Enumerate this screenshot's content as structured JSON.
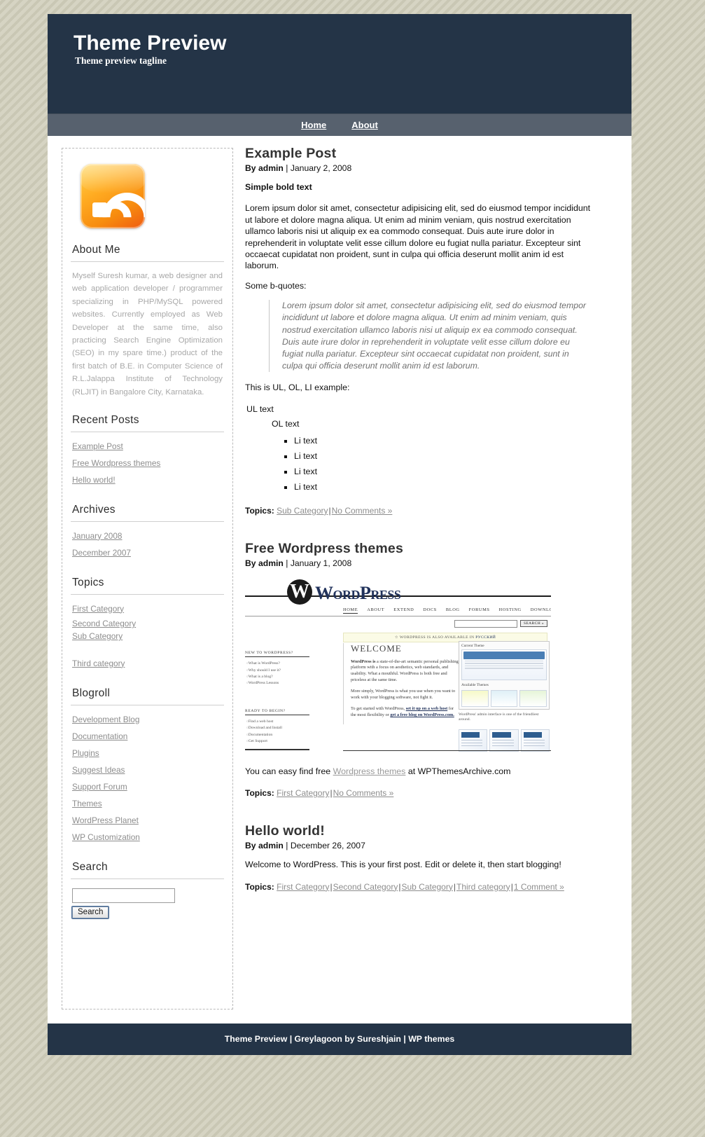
{
  "header": {
    "title": "Theme Preview",
    "tagline": "Theme preview tagline"
  },
  "nav": {
    "items": [
      {
        "label": "Home"
      },
      {
        "label": "About"
      }
    ]
  },
  "sidebar": {
    "rss_icon": "rss-feed-icon",
    "widgets": {
      "about": {
        "title": "About Me",
        "text": "Myself Suresh kumar, a web designer and web application developer / programmer specializing in PHP/MySQL powered websites. Currently employed as Web Developer at the same time, also practicing Search Engine Optimization (SEO) in my spare time.) product of the first batch of B.E. in Computer Science of R.L.Jalappa Institute of Technology (RLJIT) in Bangalore City, Karnataka."
      },
      "recent_posts": {
        "title": "Recent Posts",
        "items": [
          "Example Post",
          "Free Wordpress themes",
          "Hello world!"
        ]
      },
      "archives": {
        "title": "Archives",
        "items": [
          "January 2008",
          "December 2007"
        ]
      },
      "topics": {
        "title": "Topics",
        "items": [
          "First Category",
          "Second Category",
          "Sub Category",
          "Third category"
        ]
      },
      "blogroll": {
        "title": "Blogroll",
        "items": [
          "Development Blog",
          "Documentation",
          "Plugins",
          "Suggest Ideas",
          "Support Forum",
          "Themes",
          "WordPress Planet",
          "WP Customization"
        ]
      },
      "search": {
        "title": "Search",
        "value": "",
        "placeholder": "",
        "button_label": "Search"
      }
    }
  },
  "posts": [
    {
      "title": "Example Post",
      "byline_author": "By admin",
      "byline_sep": " | ",
      "byline_date": "January 2, 2008",
      "bold_lead": "Simple bold text",
      "body": "Lorem ipsum dolor sit amet, consectetur adipisicing elit, sed do eiusmod tempor incididunt ut labore et dolore magna aliqua. Ut enim ad minim veniam, quis nostrud exercitation ullamco laboris nisi ut aliquip ex ea commodo consequat. Duis aute irure dolor in reprehenderit in voluptate velit esse cillum dolore eu fugiat nulla pariatur. Excepteur sint occaecat cupidatat non proident, sunt in culpa qui officia deserunt mollit anim id est laborum.",
      "quote_intro": "Some b-quotes:",
      "quote": "Lorem ipsum dolor sit amet, consectetur adipisicing elit, sed do eiusmod tempor incididunt ut labore et dolore magna aliqua. Ut enim ad minim veniam, quis nostrud exercitation ullamco laboris nisi ut aliquip ex ea commodo consequat. Duis aute irure dolor in reprehenderit in voluptate velit esse cillum dolore eu fugiat nulla pariatur. Excepteur sint occaecat cupidatat non proident, sunt in culpa qui officia deserunt mollit anim id est laborum.",
      "list_intro": "This is UL, OL, LI example:",
      "ul_text": "UL text",
      "ol_text": "OL text",
      "li_items": [
        "Li text",
        "Li text",
        "Li text",
        "Li text"
      ],
      "footer_label": "Topics:",
      "footer_links": [
        "Sub Category",
        "No Comments »"
      ]
    },
    {
      "title": "Free Wordpress themes",
      "byline_author": "By admin",
      "byline_sep": " | ",
      "byline_date": "January 1, 2008",
      "themes_line_pre": "You can easy find free ",
      "themes_line_link": "Wordpress themes",
      "themes_line_post": " at WPThemesArchive.com",
      "footer_label": "Topics:",
      "footer_links": [
        "First Category",
        "No Comments »"
      ]
    },
    {
      "title": "Hello world!",
      "byline_author": "By admin",
      "byline_sep": " | ",
      "byline_date": "December 26, 2007",
      "body": "Welcome to WordPress. This is your first post. Edit or delete it, then start blogging!",
      "footer_label": "Topics:",
      "footer_links": [
        "First Category",
        "Second Category",
        "Sub Category",
        "Third category",
        "1 Comment »"
      ]
    }
  ],
  "wp_screenshot": {
    "logo_letter": "W",
    "wordmark": "WordPress",
    "nav": [
      "HOME",
      "ABOUT",
      "EXTEND",
      "DOCS",
      "BLOG",
      "FORUMS",
      "HOSTING",
      "DOWNLOAD"
    ],
    "search_button": "SEARCH »",
    "notice_pre": "☆ WORDPRESS IS ALSO AVAILABLE IN ",
    "notice_lang": "РУССКИЙ",
    "welcome": "WELCOME",
    "para1_bold": "WordPress is",
    "para1": " a state-of-the-art semantic personal publishing platform with a focus on aesthetics, web standards, and usability. What a mouthful. WordPress is both free and priceless at the same time.",
    "para2": "More simply, WordPress is what you use when you want to work with your blogging software, not fight it.",
    "para3_pre": "To get started with WordPress, ",
    "para3_link1": "set it up on a web host",
    "para3_mid": " for the most flexibility or ",
    "para3_link2": "get a free blog on WordPress.com.",
    "left_col": {
      "heading1": "NEW TO WORDPRESS?",
      "items1": [
        "What is WordPress?",
        "Why should I use it?",
        "What is a blog?",
        "WordPress Lessons"
      ],
      "heading2": "READY TO BEGIN?",
      "items2": [
        "Find a web host",
        "Download and Install",
        "Documentation",
        "Get Support"
      ]
    },
    "right_col": {
      "panel_title": "Current Theme",
      "available_title": "Available Themes",
      "caption": "WordPress' admin interface is one of the friendliest around."
    }
  },
  "footer": {
    "text": "Theme Preview | Greylagoon by Sureshjain | WP themes"
  }
}
